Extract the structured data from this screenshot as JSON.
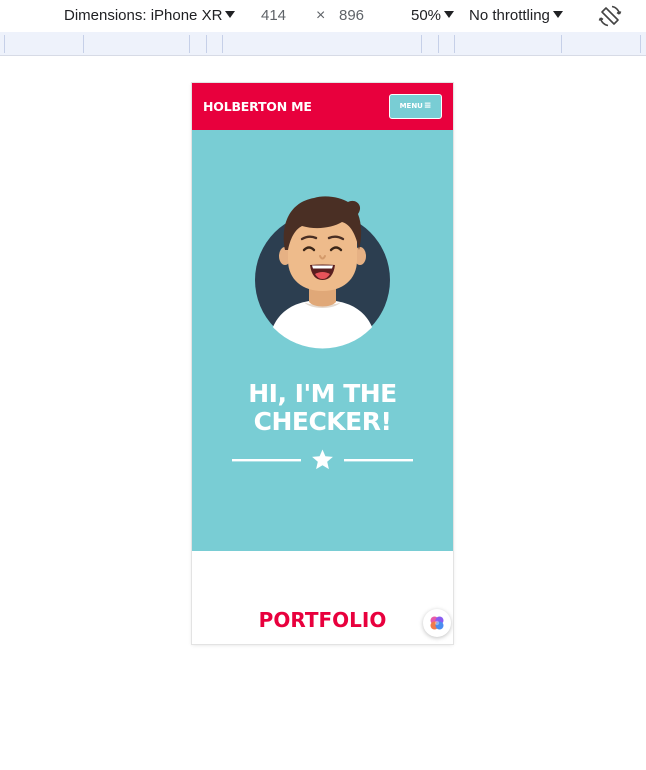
{
  "devtools": {
    "dimensions_label": "Dimensions: iPhone XR",
    "width_value": "414",
    "times": "×",
    "height_value": "896",
    "zoom_label": "50%",
    "throttle_label": "No throttling",
    "rotate_icon": "rotate-icon"
  },
  "site": {
    "brand": "HOLBERTON ME",
    "menu_label": "MENU",
    "menu_icon": "hamburger-icon",
    "hero_title_line1": "HI, I'M THE",
    "hero_title_line2": "CHECKER!",
    "divider_icon": "star-icon",
    "portfolio_title": "PORTFOLIO",
    "floating_icon": "assistant-icon"
  },
  "colors": {
    "header_bg": "#e8003d",
    "hero_bg": "#79cdd4",
    "accent_red": "#e8003d",
    "avatar_circle": "#2c3e50"
  }
}
